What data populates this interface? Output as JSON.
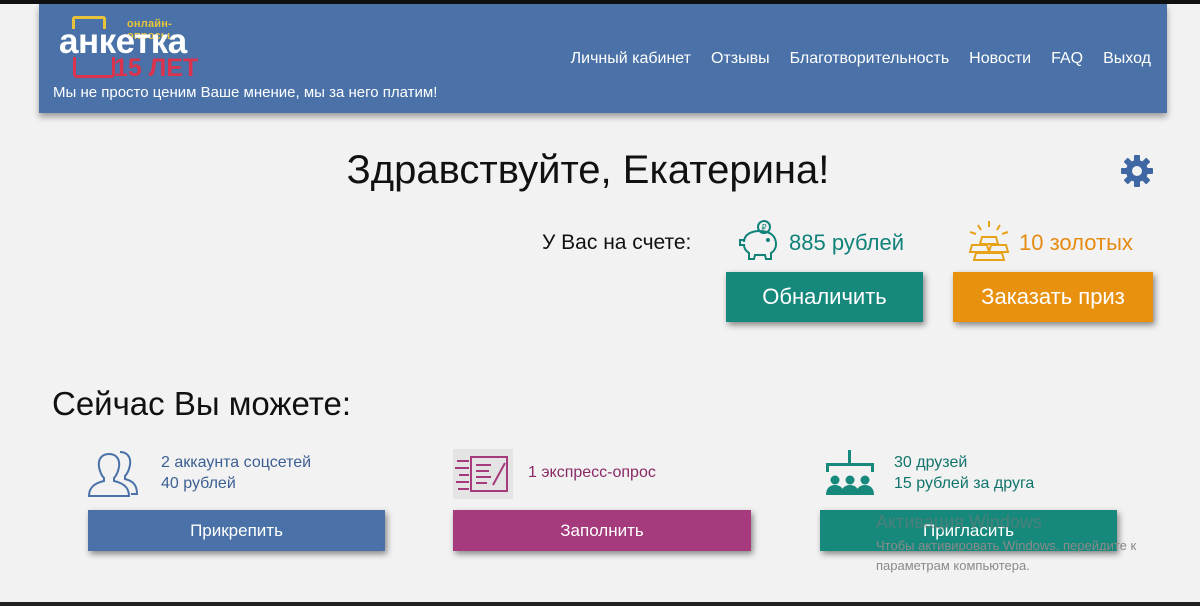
{
  "header": {
    "logo": {
      "small": "онлайн-опросы",
      "main": "анкетка",
      "sub": "15 ЛЕТ"
    },
    "tagline": "Мы не просто ценим Ваше мнение, мы за него платим!",
    "nav": [
      {
        "label": "Личный кабинет"
      },
      {
        "label": "Отзывы"
      },
      {
        "label": "Благотворительность"
      },
      {
        "label": "Новости"
      },
      {
        "label": "FAQ"
      },
      {
        "label": "Выход"
      }
    ]
  },
  "greeting": "Здравствуйте, Екатерина!",
  "balance": {
    "label": "У Вас на счете:",
    "rubles": "885 рублей",
    "gold": "10 золотых",
    "cashout_label": "Обналичить",
    "prize_label": "Заказать приз"
  },
  "now": {
    "title": "Сейчас Вы можете:",
    "cards": [
      {
        "line1": "2 аккаунта соцсетей",
        "line2": "40 рублей",
        "button": "Прикрепить"
      },
      {
        "line1": "1 экспресс-опрос",
        "line2": "",
        "button": "Заполнить"
      },
      {
        "line1": "30 друзей",
        "line2": "15 рублей за друга",
        "button": "Пригласить"
      }
    ]
  },
  "watermark": {
    "title": "Активация Windows",
    "text": "Чтобы активировать Windows, перейдите к параметрам компьютера."
  },
  "colors": {
    "header": "#4a72a8",
    "teal": "#16897c",
    "orange": "#e8910f",
    "purple": "#a53a7c"
  }
}
